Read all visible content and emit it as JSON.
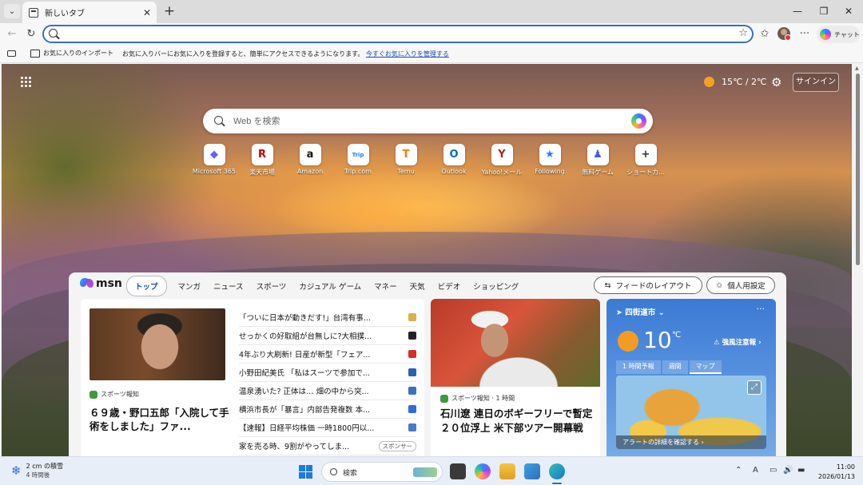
{
  "browser": {
    "tab_title": "新しいタブ",
    "new_tab_glyph": "+",
    "address_placeholder": "",
    "chat_label": "チャット"
  },
  "favorites_bar": {
    "import_label": "お気に入りのインポート",
    "message": "お気に入りバーにお気に入りを登録すると、簡単にアクセスできるようになります。",
    "manage_link": "今すぐお気に入りを管理する"
  },
  "newtab": {
    "weather_temp": "15℃ / 2℃",
    "signin_label": "サインイン",
    "search_placeholder": "Web を検索",
    "quick_links": [
      {
        "label": "Microsoft 365",
        "glyph": "◆",
        "color": "#6b5bff"
      },
      {
        "label": "楽天市場",
        "glyph": "R",
        "color": "#bf0000"
      },
      {
        "label": "Amazon",
        "glyph": "a",
        "color": "#111111"
      },
      {
        "label": "Trip.com",
        "glyph": "Trip",
        "color": "#287dfa"
      },
      {
        "label": "Temu",
        "glyph": "T",
        "color": "#fb7701"
      },
      {
        "label": "Outlook",
        "glyph": "O",
        "color": "#0a64c8"
      },
      {
        "label": "Yahoo!メール",
        "glyph": "Y",
        "color": "#b01e2d"
      },
      {
        "label": "Following",
        "glyph": "★",
        "color": "#3478f6"
      },
      {
        "label": "無料ゲーム",
        "glyph": "♟",
        "color": "#4b5cd8"
      },
      {
        "label": "ショートカ...",
        "glyph": "+",
        "color": "#333333"
      }
    ]
  },
  "feed": {
    "logo_text": "msn",
    "nav": [
      "トップ",
      "マンガ",
      "ニュース",
      "スポーツ",
      "カジュアル ゲーム",
      "マネー",
      "天気",
      "ビデオ",
      "ショッピング"
    ],
    "layout_button": "フィードのレイアウト",
    "personalize_button": "個人用設定",
    "main_source": "スポーツ報知",
    "main_headline": "６９歳・野口五郎「入院して手術をしました」ファ...",
    "list_items": [
      {
        "text": "「ついに日本が動きだす!」台湾有事...",
        "color": "#d6b24a"
      },
      {
        "text": "せっかくの好取組が台無しに?大相撲...",
        "color": "#222222"
      },
      {
        "text": "4年ぶり大刷新! 日産が新型「フェア...",
        "color": "#d92b2b"
      },
      {
        "text": "小野田紀美氏 「私はスーツで参加で...",
        "color": "#2d5fb5"
      },
      {
        "text": "温泉湧いた? 正体は… 畑の中から突...",
        "color": "#3a6fc4"
      },
      {
        "text": "横浜市長が「暴言」内部告発複数 本...",
        "color": "#2b6fd6"
      },
      {
        "text": "【速報】日経平均株価 一時1800円以...",
        "color": "#4a7ac8"
      },
      {
        "text": "家を売る時、9割がやってしま...",
        "color": ""
      }
    ],
    "sponsor_label": "スポンサー",
    "golf_source": "スポーツ報知 · 1 時間",
    "golf_headline": "石川遼 連日のボギーフリーで暫定２０位浮上 米下部ツアー開幕戦",
    "weather": {
      "location": "四街道市",
      "temp": "10",
      "unit": "℃",
      "alert": "強風注意報",
      "tabs": [
        "1 時間予報",
        "週間",
        "マップ"
      ],
      "map_footer": "アラートの詳細を確認する"
    }
  },
  "taskbar": {
    "weather_line1": "2 cm の積雪",
    "weather_line2": "4 時間後",
    "search_label": "検索",
    "time": "11:00",
    "date": "2026/01/13"
  }
}
